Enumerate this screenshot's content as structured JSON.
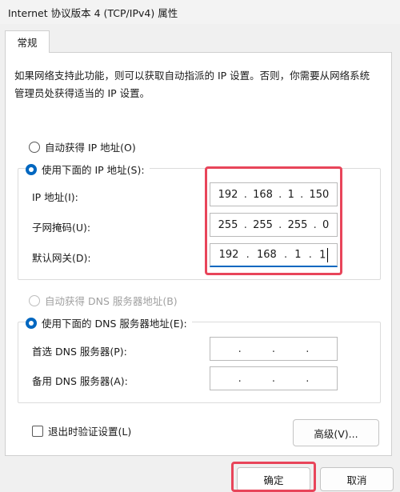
{
  "window": {
    "title": "Internet 协议版本 4 (TCP/IPv4) 属性"
  },
  "tabs": [
    {
      "label": "常规"
    }
  ],
  "description": "如果网络支持此功能，则可以获取自动指派的 IP 设置。否则，你需要从网络系统管理员处获得适当的 IP 设置。",
  "ip_section": {
    "auto_label": "自动获得 IP 地址(O)",
    "manual_label": "使用下面的 IP 地址(S):",
    "fields": [
      {
        "label": "IP 地址(I):",
        "octets": [
          "192",
          "168",
          "1",
          "150"
        ]
      },
      {
        "label": "子网掩码(U):",
        "octets": [
          "255",
          "255",
          "255",
          "0"
        ]
      },
      {
        "label": "默认网关(D):",
        "octets": [
          "192",
          "168",
          "1",
          "1"
        ]
      }
    ]
  },
  "dns_section": {
    "auto_label": "自动获得 DNS 服务器地址(B)",
    "manual_label": "使用下面的 DNS 服务器地址(E):",
    "fields": [
      {
        "label": "首选 DNS 服务器(P):",
        "octets": [
          "",
          "",
          "",
          ""
        ]
      },
      {
        "label": "备用 DNS 服务器(A):",
        "octets": [
          "",
          "",
          "",
          ""
        ]
      }
    ]
  },
  "validate_label": "退出时验证设置(L)",
  "buttons": {
    "advanced": "高级(V)...",
    "ok": "确定",
    "cancel": "取消"
  },
  "colors": {
    "accent": "#0067c0",
    "highlight": "#e8455a"
  }
}
